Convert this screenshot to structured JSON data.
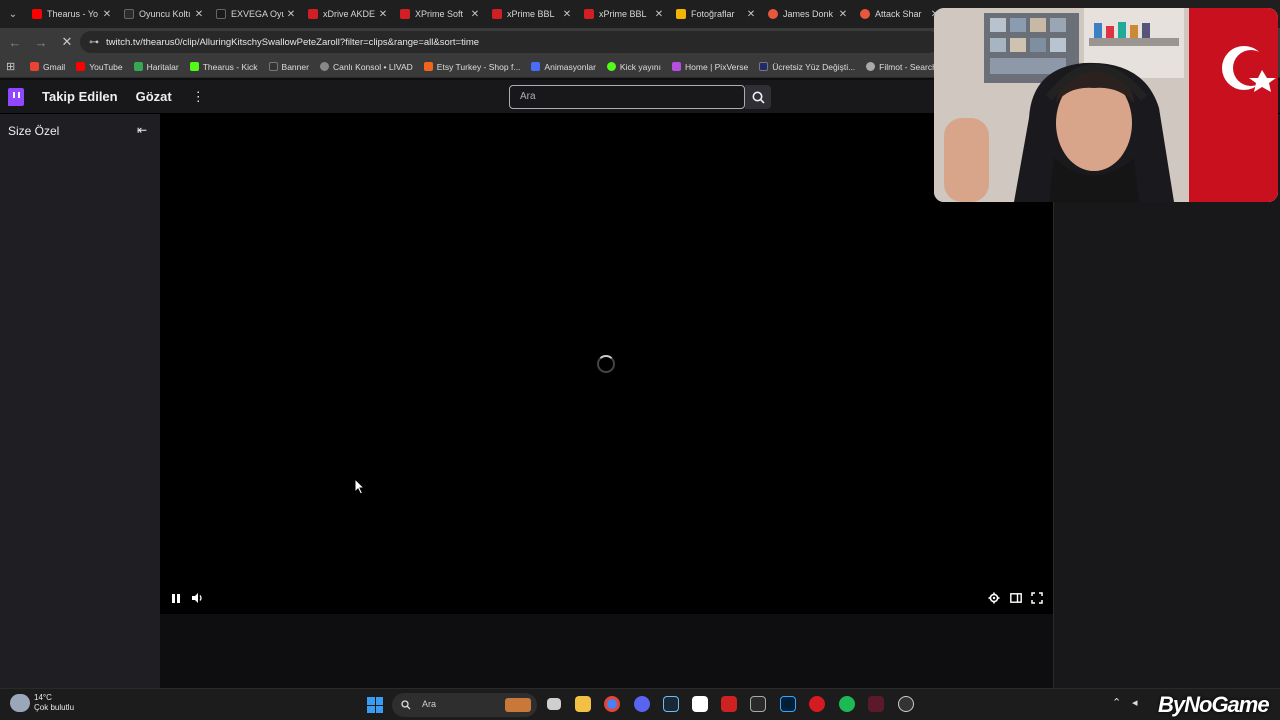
{
  "browser": {
    "tabs": [
      {
        "label": "Thearus - Yo",
        "color": "#ff0000"
      },
      {
        "label": "Oyuncu Koltı",
        "color": "#2b2b2b"
      },
      {
        "label": "EXVEGA Oyu",
        "color": "#1a1a1a"
      },
      {
        "label": "xDrive AKDE",
        "color": "#d21f26"
      },
      {
        "label": "XPrime Soft",
        "color": "#d21f26"
      },
      {
        "label": "xPrime BBL",
        "color": "#d21f26"
      },
      {
        "label": "xPrime BBL",
        "color": "#d21f26"
      },
      {
        "label": "Fotoğraflar",
        "color": "#f4b400"
      },
      {
        "label": "James Donk",
        "color": "#e8573d"
      },
      {
        "label": "Attack Shar",
        "color": "#e8573d"
      }
    ],
    "url": "twitch.tv/thearus0/clip/AlluringKitschySwallowPeteZaroll?filter=clips&range=all&sort=time",
    "bookmarks": [
      {
        "label": "Gmail",
        "color": "#ea4335"
      },
      {
        "label": "YouTube",
        "color": "#ff0000"
      },
      {
        "label": "Haritalar",
        "color": "#34a853"
      },
      {
        "label": "Thearus - Kick",
        "color": "#53fc18"
      },
      {
        "label": "Banner",
        "color": "#333333"
      },
      {
        "label": "Canlı Konsol • LIVAD",
        "color": "#888888"
      },
      {
        "label": "Etsy Turkey - Shop f...",
        "color": "#f1641e"
      },
      {
        "label": "Animasyonlar",
        "color": "#4a6cf7"
      },
      {
        "label": "Kick yayını",
        "color": "#53fc18"
      },
      {
        "label": "Home | PixVerse",
        "color": "#b44fe0"
      },
      {
        "label": "Ücretsiz Yüz Değişti...",
        "color": "#1f2a6e"
      },
      {
        "label": "Filmot - Search in Y...",
        "color": "#aaaaaa"
      }
    ]
  },
  "twitch": {
    "nav": {
      "following": "Takip Edilen",
      "browse": "Gözat",
      "more": "⋮",
      "search_placeholder": "Ara"
    },
    "sidebar": {
      "title": "Size Özel",
      "collapse_icon": "⇤"
    },
    "player": {
      "state": "loading"
    }
  },
  "taskbar": {
    "weather_temp": "14°C",
    "weather_desc": "Çok bulutlu",
    "search_label": "Ara"
  },
  "watermark": "ByNoGame"
}
